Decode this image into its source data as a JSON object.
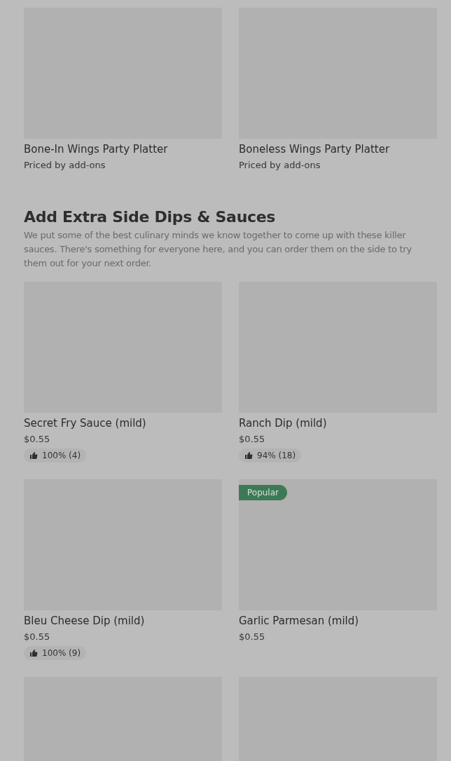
{
  "top_items": [
    {
      "image": {
        "kind": "placeholder"
      },
      "title": "Bone-In Wings Party Platter",
      "price": "Priced by add-ons"
    },
    {
      "image": {
        "kind": "placeholder"
      },
      "title": "Boneless Wings Party Platter",
      "price": "Priced by add-ons"
    }
  ],
  "section": {
    "title": "Add Extra Side Dips & Sauces",
    "description": "We put some of the best culinary minds we know together to come up with these killer sauces. There's something for everyone here, and you can order them on the side to try them out for your next order.",
    "rows": [
      {
        "items": [
          {
            "image": {
              "kind": "placeholder"
            },
            "title": "Secret Fry Sauce (mild)",
            "price": "$0.55",
            "rating": "100% (4)"
          },
          {
            "image": {
              "kind": "placeholder"
            },
            "title": "Ranch Dip (mild)",
            "price": "$0.55",
            "rating": "94% (18)"
          }
        ]
      },
      {
        "items": [
          {
            "image": {
              "kind": "placeholder"
            },
            "title": "Bleu Cheese Dip (mild)",
            "price": "$0.55",
            "rating": "100% (9)"
          },
          {
            "image": {
              "kind": "placeholder"
            },
            "badge": "Popular",
            "title": "Garlic Parmesan (mild)",
            "price": "$0.55"
          }
        ]
      },
      {
        "items": [
          {
            "image": {
              "kind": "placeholder"
            }
          },
          {
            "image": {
              "kind": "placeholder"
            }
          }
        ]
      }
    ]
  }
}
